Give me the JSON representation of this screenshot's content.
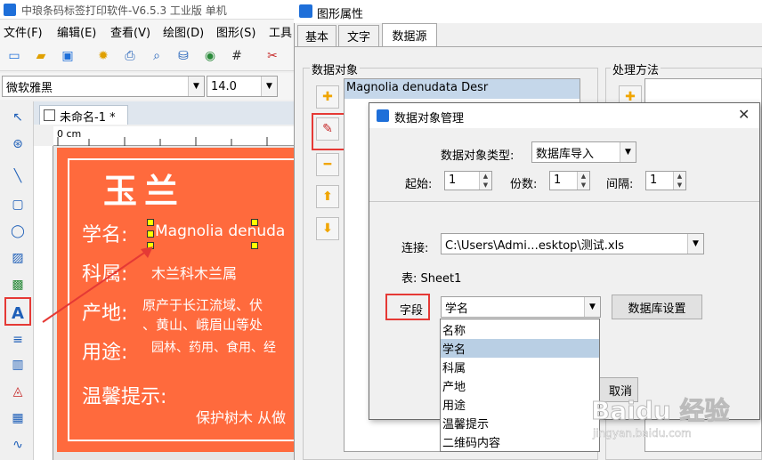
{
  "app": {
    "title": "中琅条码标签打印软件-V6.5.3 工业版 单机",
    "menu": [
      "文件(F)",
      "编辑(E)",
      "查看(V)",
      "绘图(D)",
      "图形(S)",
      "工具"
    ],
    "font_name": "微软雅黑",
    "font_size": "14.0",
    "doc_tab": "未命名-1 *",
    "ruler_unit": "0 cm"
  },
  "label": {
    "heading": "玉兰",
    "rows": [
      {
        "key": "学名:",
        "value": "Magnolia denuda"
      },
      {
        "key": "科属:",
        "value": "木兰科木兰属"
      },
      {
        "key": "产地:",
        "value": "原产于长江流域、伏"
      },
      {
        "key": "",
        "value": "、黄山、峨眉山等处"
      },
      {
        "key": "用途:",
        "value": "园林、药用、食用、经"
      },
      {
        "key": "温馨提示:",
        "value": ""
      },
      {
        "key": "",
        "value": "保护树木 从做"
      }
    ]
  },
  "properties": {
    "title": "图形属性",
    "tabs": [
      "基本",
      "文字",
      "数据源"
    ],
    "active_tab": "数据源",
    "data_object_group": "数据对象",
    "process_group": "处理方法",
    "data_object_item": "Magnolia denudata Desr"
  },
  "manager": {
    "title": "数据对象管理",
    "type_label": "数据对象类型:",
    "type_value": "数据库导入",
    "start_label": "起始:",
    "start_value": "1",
    "copies_label": "份数:",
    "copies_value": "1",
    "interval_label": "间隔:",
    "interval_value": "1",
    "conn_label": "连接:",
    "conn_value": "C:\\Users\\Admi…esktop\\测试.xls",
    "table_label": "表: Sheet1",
    "field_label": "字段",
    "field_value": "学名",
    "db_settings": "数据库设置",
    "cancel": "取消",
    "field_options": [
      "名称",
      "学名",
      "科属",
      "产地",
      "用途",
      "温馨提示",
      "二维码内容"
    ],
    "selected_option": "学名"
  },
  "watermark": {
    "text": "Baidu 经验",
    "url": "jingyan.baidu.com"
  }
}
